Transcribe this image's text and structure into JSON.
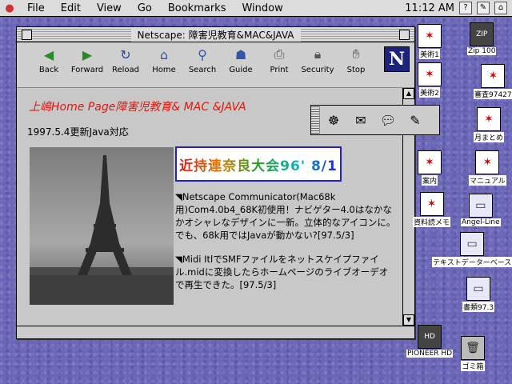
{
  "menubar": {
    "apple": "",
    "items": [
      "File",
      "Edit",
      "View",
      "Go",
      "Bookmarks",
      "Window"
    ],
    "clock": "11:12 AM"
  },
  "window": {
    "title": "Netscape: 障害児教育&MAC&JAVA",
    "toolbar": [
      {
        "label": "Back",
        "icon": "back-arrow-icon"
      },
      {
        "label": "Forward",
        "icon": "forward-arrow-icon"
      },
      {
        "label": "Reload",
        "icon": "reload-icon"
      },
      {
        "label": "Home",
        "icon": "home-icon"
      },
      {
        "label": "Search",
        "icon": "search-icon"
      },
      {
        "label": "Guide",
        "icon": "guide-icon"
      },
      {
        "label": "Print",
        "icon": "print-icon"
      },
      {
        "label": "Security",
        "icon": "security-lock-icon"
      },
      {
        "label": "Stop",
        "icon": "stop-icon"
      }
    ],
    "logo": "N"
  },
  "page": {
    "heading": "上嶋Home Page障害児教育& MAC &JAVA",
    "update": "1997.5.4更新Java対応",
    "banner": "近持連奈良大会96' 8/1",
    "news": [
      "◥Netscape Communicator(Mac68k用)Com4.0b4_68K初使用！ナビゲター4.0はなかなかオシャレなデザインに一新。立体的なアイコンに。でも、68k用ではJavaが動かない?[97.5/3]",
      "◥Midi ItlでSMFファイルをネットスケイプファイル.midに変換したらホームページのライブオーデオで再生できた。[97.5/3]"
    ]
  },
  "desktop": {
    "icons": [
      {
        "name": "Zip 100",
        "kind": "disk"
      },
      {
        "name": "美術1",
        "kind": "doc"
      },
      {
        "name": "美術2",
        "kind": "doc"
      },
      {
        "name": "審査97427",
        "kind": "doc"
      },
      {
        "name": "月まとめ",
        "kind": "doc"
      },
      {
        "name": "案内",
        "kind": "doc"
      },
      {
        "name": "マニュアル",
        "kind": "doc"
      },
      {
        "name": "資料読メモ",
        "kind": "doc"
      },
      {
        "name": "Angel-Line",
        "kind": "folder"
      },
      {
        "name": "テキストデーターベース",
        "kind": "folder"
      },
      {
        "name": "書類97.3",
        "kind": "folder"
      },
      {
        "name": "PIONEER HD",
        "kind": "disk"
      },
      {
        "name": "ゴミ箱",
        "kind": "trash"
      }
    ]
  },
  "colors": {
    "heading": "#e0180f",
    "desktop": "#6a66b8",
    "banner_border": "#2020d0"
  }
}
